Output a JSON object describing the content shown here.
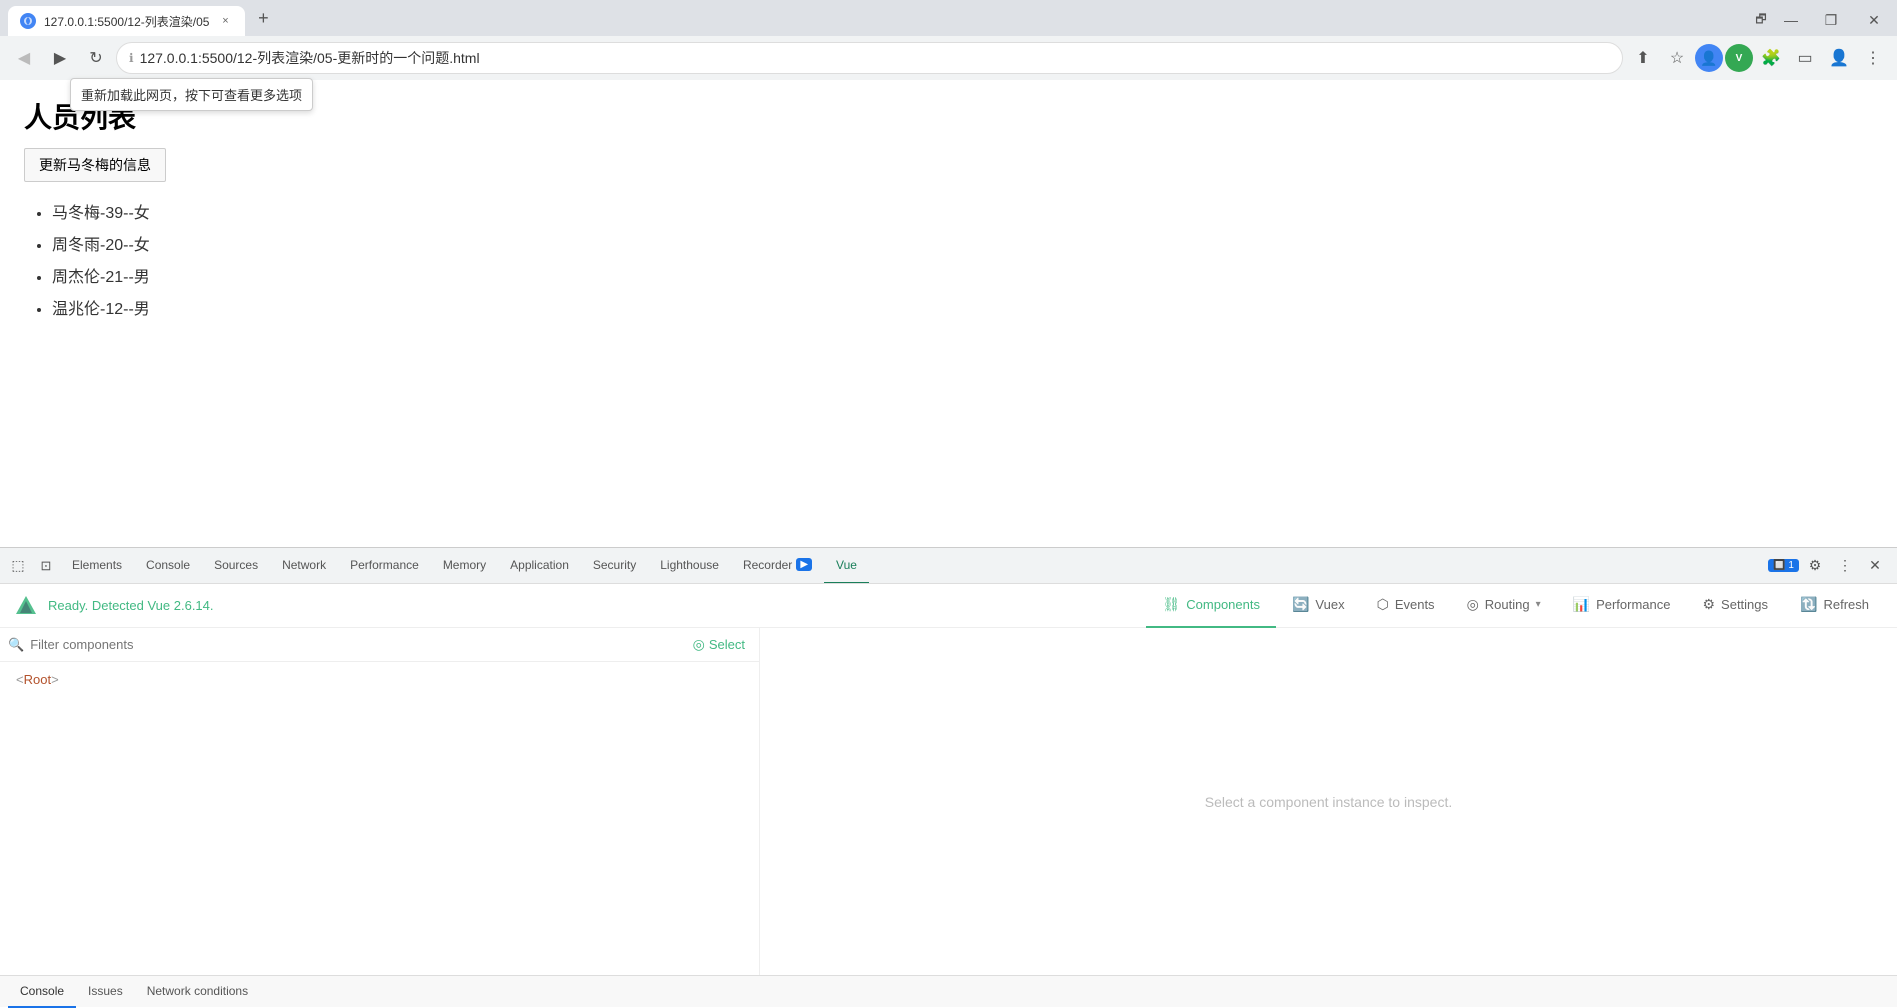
{
  "browser": {
    "tab": {
      "favicon_color": "#4285f4",
      "title": "127.0.0.1:5500/12-列表渲染/05",
      "close_label": "×"
    },
    "new_tab_label": "+",
    "window_controls": {
      "minimize": "—",
      "maximize": "❐",
      "close": "✕"
    },
    "nav": {
      "back_disabled": true,
      "forward_disabled": false
    },
    "address": "127.0.0.1:5500/12-列表渲染/05-更新时的一个问题.html",
    "reload_tooltip": "重新加载此网页，按下可查看更多选项"
  },
  "page": {
    "title": "人员列表",
    "update_button": "更新马冬梅的信息",
    "persons": [
      "马冬梅-39--女",
      "周冬雨-20--女",
      "周杰伦-21--男",
      "温兆伦-12--男"
    ]
  },
  "devtools": {
    "tabs": [
      {
        "label": "Elements",
        "active": false
      },
      {
        "label": "Console",
        "active": false
      },
      {
        "label": "Sources",
        "active": false
      },
      {
        "label": "Network",
        "active": false
      },
      {
        "label": "Performance",
        "active": false
      },
      {
        "label": "Memory",
        "active": false
      },
      {
        "label": "Application",
        "active": false
      },
      {
        "label": "Security",
        "active": false
      },
      {
        "label": "Lighthouse",
        "active": false
      },
      {
        "label": "Recorder 🔴",
        "active": false
      },
      {
        "label": "Vue",
        "active": true
      }
    ],
    "badge": "1",
    "settings_icon": "⚙",
    "more_icon": "⋮"
  },
  "vue_devtools": {
    "logo_color": "#42b983",
    "status": "Ready. Detected Vue 2.6.14.",
    "nav_items": [
      {
        "icon": "⛓",
        "label": "Components",
        "active": true,
        "dropdown": false
      },
      {
        "icon": "🔄",
        "label": "Vuex",
        "active": false,
        "dropdown": false
      },
      {
        "icon": "⬡",
        "label": "Events",
        "active": false,
        "dropdown": false
      },
      {
        "icon": "◎",
        "label": "Routing",
        "active": false,
        "dropdown": true
      },
      {
        "icon": "📊",
        "label": "Performance",
        "active": false,
        "dropdown": false
      },
      {
        "icon": "⚙",
        "label": "Settings",
        "active": false,
        "dropdown": false
      },
      {
        "icon": "🔃",
        "label": "Refresh",
        "active": false,
        "dropdown": false
      }
    ],
    "filter_placeholder": "Filter components",
    "select_label": "Select",
    "tree": {
      "root_label": "< Root >"
    },
    "right_placeholder": "Select a component instance to inspect."
  },
  "bottom_tabs": [
    {
      "label": "Console",
      "active": true
    },
    {
      "label": "Issues",
      "active": false
    },
    {
      "label": "Network conditions",
      "active": false
    }
  ]
}
